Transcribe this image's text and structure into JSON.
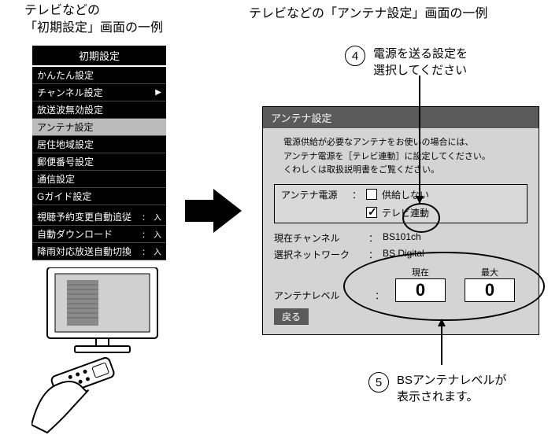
{
  "headings": {
    "left_l1": "テレビなどの",
    "left_l2": "「初期設定」画面の一例",
    "right": "テレビなどの「アンテナ設定」画面の一例"
  },
  "menu": {
    "title": "初期設定",
    "items": [
      {
        "label": "かんたん設定",
        "suffix": ""
      },
      {
        "label": "チャンネル設定",
        "suffix": "▶"
      },
      {
        "label": "放送波無効設定",
        "suffix": ""
      },
      {
        "label": "アンテナ設定",
        "suffix": "",
        "selected": true
      },
      {
        "label": "居住地域設定",
        "suffix": ""
      },
      {
        "label": "郵便番号設定",
        "suffix": ""
      },
      {
        "label": "通信設定",
        "suffix": ""
      },
      {
        "label": "Gガイド設定",
        "suffix": ""
      }
    ],
    "items2": [
      {
        "label": "視聴予約変更自動追従",
        "suffix": "：　入"
      },
      {
        "label": "自動ダウンロード",
        "suffix": "：　入"
      },
      {
        "label": "降雨対応放送自動切換",
        "suffix": "：　入"
      }
    ]
  },
  "panel": {
    "title": "アンテナ設定",
    "instr_l1": "電源供給が必要なアンテナをお使いの場合には、",
    "instr_l2": "アンテナ電源を［テレビ連動］に設定してください。",
    "instr_l3": "くわしくは取扱説明書をご覧ください。",
    "power_label": "アンテナ電源",
    "opt1": "供給しない",
    "opt2": "テレビ連動",
    "ch_label": "現在チャンネル",
    "ch_value": "BS101ch",
    "net_label": "選択ネットワーク",
    "net_value": "BS Digital",
    "level_label": "アンテナレベル",
    "level_cur_label": "現在",
    "level_cur_value": "0",
    "level_max_label": "最大",
    "level_max_value": "0",
    "back": "戻る"
  },
  "callouts": {
    "c4_num": "4",
    "c4_l1": "電源を送る設定を",
    "c4_l2": "選択してください",
    "c5_num": "5",
    "c5_l1": "BSアンテナレベルが",
    "c5_l2": "表示されます。"
  }
}
